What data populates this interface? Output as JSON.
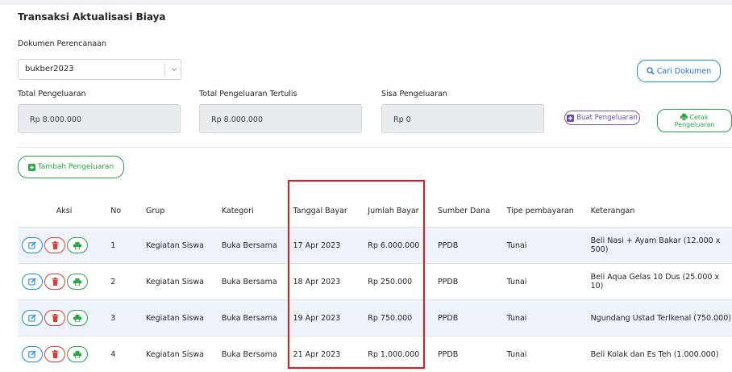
{
  "page": {
    "title": "Transaksi Aktualisasi Biaya",
    "dokumen_label": "Dokumen Perencanaan",
    "dokumen_value": "bukber2023",
    "cari_button": "Cari Dokumen",
    "total_label": "Total Pengeluaran",
    "total_value": "Rp 8.000.000",
    "tertulis_label": "Total Pengeluaran Tertulis",
    "tertulis_value": "Rp 8.000.000",
    "sisa_label": "Sisa Pengeluaran",
    "sisa_value": "Rp 0",
    "buat_button": "Buat Pengeluaran",
    "cetak_button_line1": "Cetak",
    "cetak_button_line2": "Pengeluaran",
    "tambah_button": "Tambah Pengeluaran"
  },
  "table": {
    "headers": [
      "Aksi",
      "No",
      "Grup",
      "Kategori",
      "Tanggal Bayar",
      "Jumlah Bayar",
      "Sumber Dana",
      "Tipe pembayaran",
      "Keterangan"
    ],
    "rows": [
      {
        "no": "1",
        "grup": "Kegiatan Siswa",
        "kategori": "Buka Bersama",
        "tanggal": "17 Apr 2023",
        "jumlah": "Rp 6.000.000",
        "sumber": "PPDB",
        "tipe": "Tunai",
        "ket": "Beli Nasi + Ayam Bakar (12.000 x 500)"
      },
      {
        "no": "2",
        "grup": "Kegiatan Siswa",
        "kategori": "Buka Bersama",
        "tanggal": "18 Apr 2023",
        "jumlah": "Rp 250.000",
        "sumber": "PPDB",
        "tipe": "Tunai",
        "ket": "Beli Aqua Gelas 10 Dus (25.000 x 10)"
      },
      {
        "no": "3",
        "grup": "Kegiatan Siswa",
        "kategori": "Buka Bersama",
        "tanggal": "19 Apr 2023",
        "jumlah": "Rp 750.000",
        "sumber": "PPDB",
        "tipe": "Tunai",
        "ket": "Ngundang Ustad Terlkenal (750.000)"
      },
      {
        "no": "4",
        "grup": "Kegiatan Siswa",
        "kategori": "Buka Bersama",
        "tanggal": "21 Apr 2023",
        "jumlah": "Rp 1.000.000",
        "sumber": "PPDB",
        "tipe": "Tunai",
        "ket": "Beli Kolak dan Es Teh (1.000.000)"
      }
    ]
  },
  "colors": {
    "accent_blue": "#1e88e5",
    "accent_purple": "#7e57c2",
    "accent_green": "#28a745",
    "danger_red": "#e53935",
    "highlight_red": "#e8191c",
    "row_alt": "#eef3fc"
  },
  "icons": {
    "select": "chevron-down-icon",
    "cari": "search-icon",
    "buat": "plus-square-icon",
    "cetak": "printer-icon",
    "tambah": "plus-square-icon",
    "edit": "edit-icon",
    "delete": "trash-icon",
    "print": "printer-icon"
  }
}
